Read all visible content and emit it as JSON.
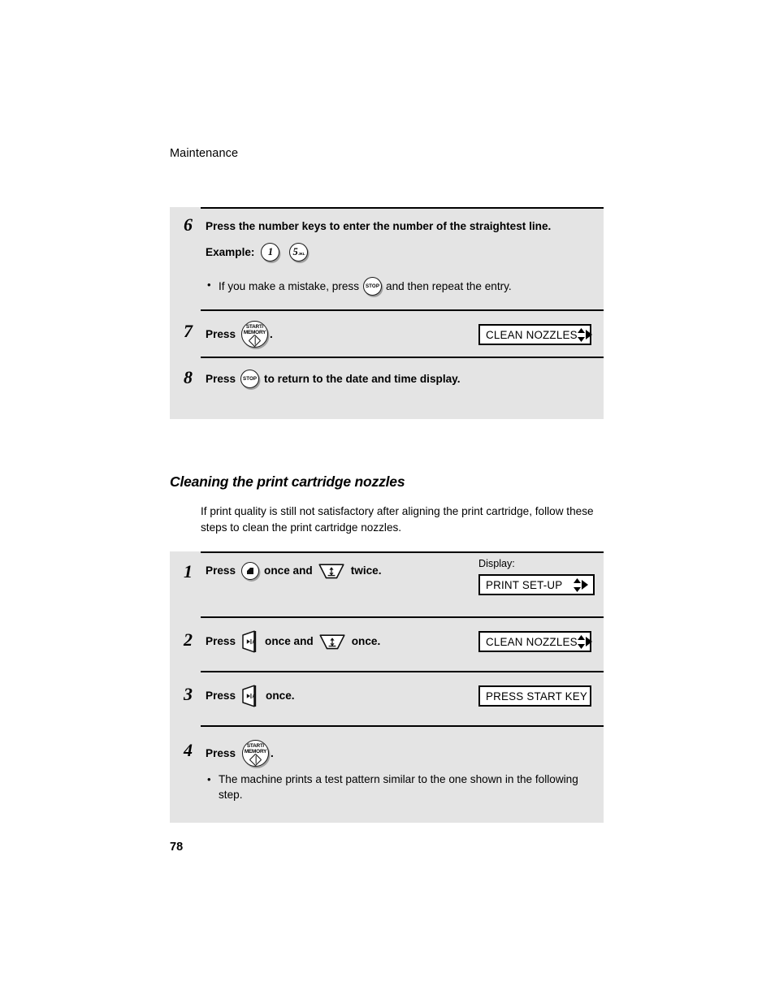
{
  "document": {
    "running_head": "Maintenance",
    "page_number": "78"
  },
  "panel_a": {
    "steps": [
      {
        "number": "6",
        "line1": "Press the number keys to enter the number of the straightest line.",
        "example_label": "Example:",
        "example_keys": [
          {
            "icon": "number-key-1",
            "digit": "1",
            "letters": ""
          },
          {
            "icon": "number-key-5",
            "digit": "5",
            "letters": "JKL"
          }
        ],
        "bullet_before": "If you make a mistake, press",
        "bullet_icon": "stop-key",
        "bullet_after": "and then repeat the entry."
      },
      {
        "number": "7",
        "press_label": "Press",
        "icon": "start-memory-key",
        "after_icon": ".",
        "display_text": "CLEAN NOZZLES",
        "display_arrows": "up-down-right"
      },
      {
        "number": "8",
        "press_label": "Press",
        "icon": "stop-key",
        "after_icon": "to return to the date and time display."
      }
    ]
  },
  "section": {
    "heading": "Cleaning the print cartridge nozzles",
    "paragraph": "If print quality is still not satisfactory after aligning the print cartridge, follow these steps to clean the print cartridge nozzles."
  },
  "panel_b": {
    "display_label": "Display:",
    "steps": [
      {
        "number": "1",
        "press_label": "Press",
        "icon1": "function-key",
        "mid_text": "once and",
        "icon2": "down-arrow-key",
        "end_text": "twice.",
        "display_text": "PRINT SET-UP",
        "display_arrows": "up-down-right"
      },
      {
        "number": "2",
        "press_label": "Press",
        "icon1": "right-arrow-key",
        "mid_text": "once and",
        "icon2": "down-arrow-key",
        "end_text": "once.",
        "display_text": "CLEAN NOZZLES",
        "display_arrows": "up-down-right"
      },
      {
        "number": "3",
        "press_label": "Press",
        "icon1": "right-arrow-key",
        "end_text": "once.",
        "display_text": "PRESS START KEY",
        "display_arrows": "none"
      },
      {
        "number": "4",
        "press_label": "Press",
        "icon1": "start-memory-key",
        "end_text": ".",
        "bullet": "The machine prints a test pattern similar to the one shown in the following step."
      }
    ]
  },
  "start_memory_key": {
    "line1": "START/",
    "line2": "MEMORY",
    "symbol": "power-diamond-icon"
  },
  "stop_key": {
    "label": "STOP"
  },
  "colors": {
    "panel_background": "#e4e4e4",
    "page_background": "#ffffff",
    "text": "#000000",
    "rule": "#000000"
  }
}
